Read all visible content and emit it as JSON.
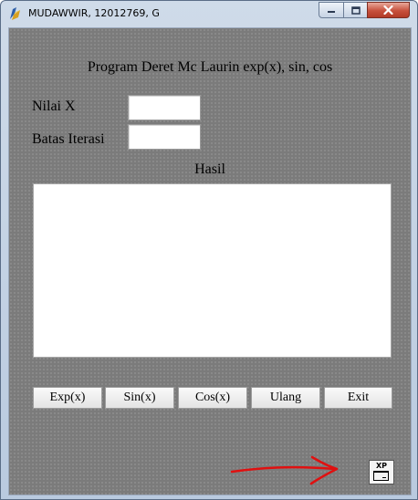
{
  "window": {
    "title": "MUDAWWIR, 12012769, G",
    "controls": {
      "minimize": "minimize-icon",
      "maximize": "maximize-icon",
      "close": "close-icon"
    }
  },
  "form": {
    "heading": "Program Deret Mc Laurin exp(x), sin, cos",
    "nilai_x_label": "Nilai X",
    "nilai_x_value": "",
    "batas_iterasi_label": "Batas Iterasi",
    "batas_iterasi_value": "",
    "hasil_label": "Hasil",
    "hasil_value": ""
  },
  "buttons": {
    "exp": "Exp(x)",
    "sin": "Sin(x)",
    "cos": "Cos(x)",
    "ulang": "Ulang",
    "exit": "Exit"
  },
  "xp_button": {
    "label": "XP",
    "icon": "window-icon"
  },
  "annotation": {
    "arrow_color": "#e01010"
  },
  "colors": {
    "form_background": "#7b7b7b",
    "close_button": "#c7503c"
  }
}
